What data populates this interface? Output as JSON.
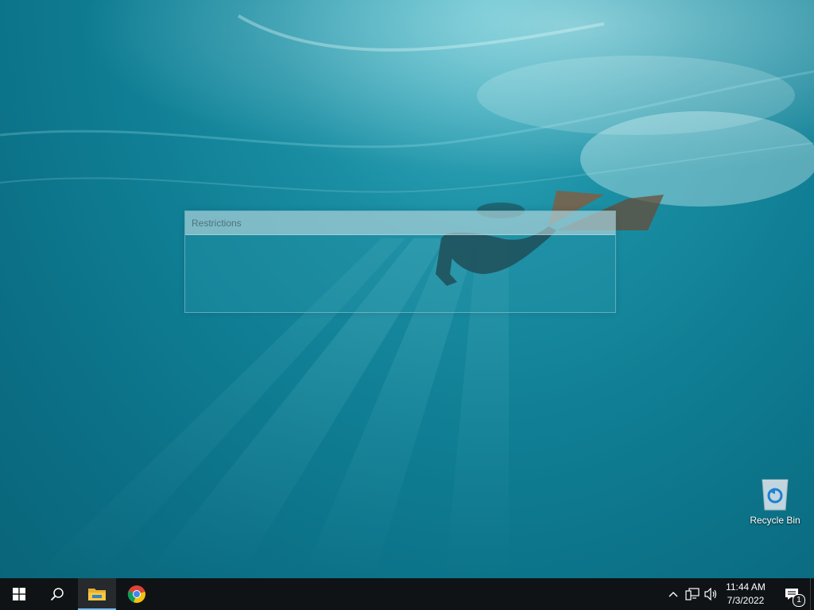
{
  "desktop": {
    "dialog": {
      "title": "Restrictions"
    },
    "icons": [
      {
        "label": "Recycle Bin",
        "icon": "recycle-bin-icon"
      }
    ]
  },
  "taskbar": {
    "start": {
      "icon": "windows-logo-icon"
    },
    "search": {
      "icon": "search-icon"
    },
    "apps": [
      {
        "name": "File Explorer",
        "icon": "folder-icon",
        "active": true
      },
      {
        "name": "Google Chrome",
        "icon": "chrome-icon",
        "active": false
      }
    ],
    "tray": {
      "overflow_icon": "chevron-up-icon",
      "network_icon": "network-icon",
      "volume_icon": "speaker-icon",
      "time": "11:44 AM",
      "date": "7/3/2022",
      "notifications_count": "1"
    }
  },
  "colors": {
    "taskbar": "#0f1316",
    "accent": "#76b9ed",
    "water": "#0f7d93"
  }
}
